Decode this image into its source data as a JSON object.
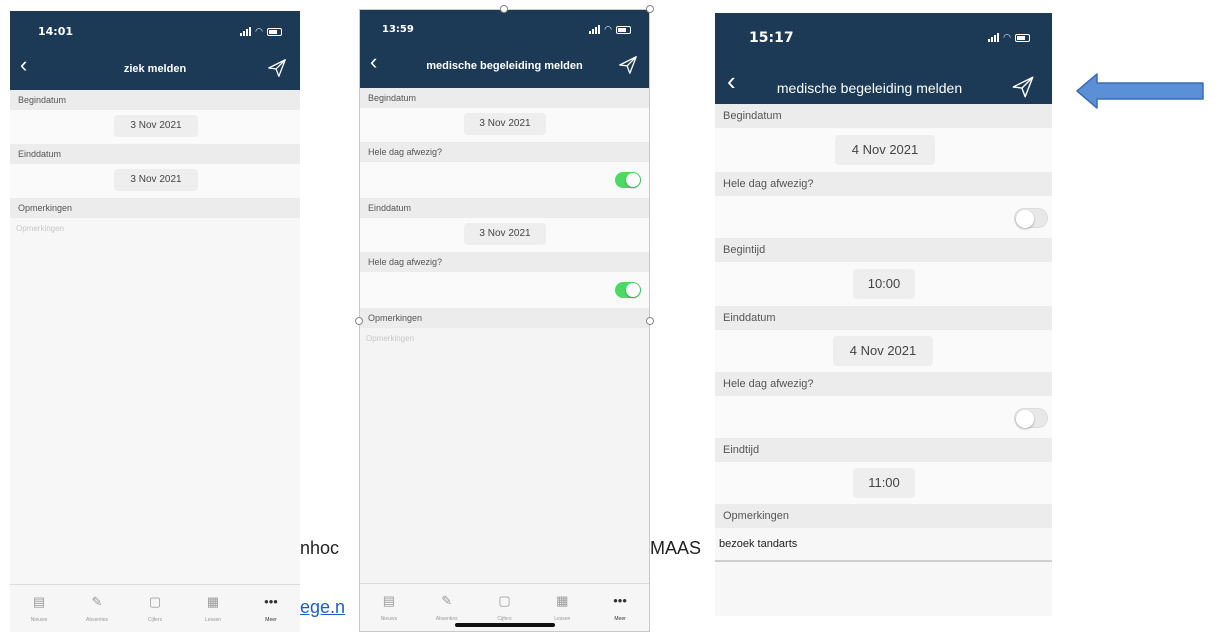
{
  "background_text": {
    "left_fragment": "nhoc",
    "right_fragment": "MAAS",
    "link_fragment": "ege.n"
  },
  "phone1": {
    "time": "14:01",
    "title": "ziek melden",
    "begin_label": "Begindatum",
    "begin_value": "3 Nov 2021",
    "end_label": "Einddatum",
    "end_value": "3 Nov 2021",
    "remarks_label": "Opmerkingen",
    "remarks_placeholder": "Opmerkingen",
    "tabs": [
      {
        "icon": "newspaper-icon",
        "label": "Nieuws"
      },
      {
        "icon": "pencil-icon",
        "label": "Absenties"
      },
      {
        "icon": "clipboard-icon",
        "label": "Cijfers"
      },
      {
        "icon": "calendar-icon",
        "label": "Lessen"
      },
      {
        "icon": "more-icon",
        "label": "Meer"
      }
    ]
  },
  "phone2": {
    "time": "13:59",
    "title": "medische begeleiding melden",
    "begin_label": "Begindatum",
    "begin_value": "3 Nov 2021",
    "allday1_label": "Hele dag afwezig?",
    "allday1_on": true,
    "end_label": "Einddatum",
    "end_value": "3 Nov 2021",
    "allday2_label": "Hele dag afwezig?",
    "allday2_on": true,
    "remarks_label": "Opmerkingen",
    "remarks_placeholder": "Opmerkingen",
    "tabs": [
      {
        "icon": "newspaper-icon",
        "label": "Nieuws"
      },
      {
        "icon": "pencil-icon",
        "label": "Absenties"
      },
      {
        "icon": "clipboard-icon",
        "label": "Cijfers"
      },
      {
        "icon": "calendar-icon",
        "label": "Lessen"
      },
      {
        "icon": "more-icon",
        "label": "Meer"
      }
    ]
  },
  "phone3": {
    "time": "15:17",
    "title": "medische begeleiding melden",
    "begin_label": "Begindatum",
    "begin_value": "4 Nov 2021",
    "allday1_label": "Hele dag afwezig?",
    "allday1_on": false,
    "begin_time_label": "Begintijd",
    "begin_time_value": "10:00",
    "end_label": "Einddatum",
    "end_value": "4 Nov 2021",
    "allday2_label": "Hele dag afwezig?",
    "allday2_on": false,
    "end_time_label": "Eindtijd",
    "end_time_value": "11:00",
    "remarks_label": "Opmerkingen",
    "remarks_value": "bezoek tandarts"
  },
  "colors": {
    "navbar": "#1c3a56",
    "toggle_on": "#4cd964",
    "arrow_fill": "#5b8fd6",
    "arrow_stroke": "#3b6db4"
  }
}
